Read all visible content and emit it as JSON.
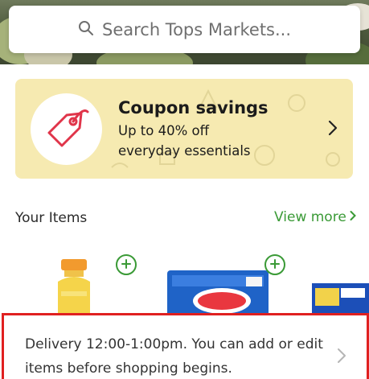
{
  "search": {
    "placeholder": "Search Tops Markets..."
  },
  "coupon": {
    "title": "Coupon savings",
    "line1": "Up to 40% off",
    "line2": "everyday essentials"
  },
  "your_items": {
    "title": "Your Items",
    "view_more": "View more"
  },
  "delivery": {
    "line1": "Delivery 12:00-1:00pm. You can add or edit",
    "line2": "items before shopping begins."
  },
  "colors": {
    "accent_green": "#3a9a36",
    "coupon_bg": "#f6eab1",
    "tag_red": "#e0354a",
    "highlight_red": "#e02020"
  }
}
